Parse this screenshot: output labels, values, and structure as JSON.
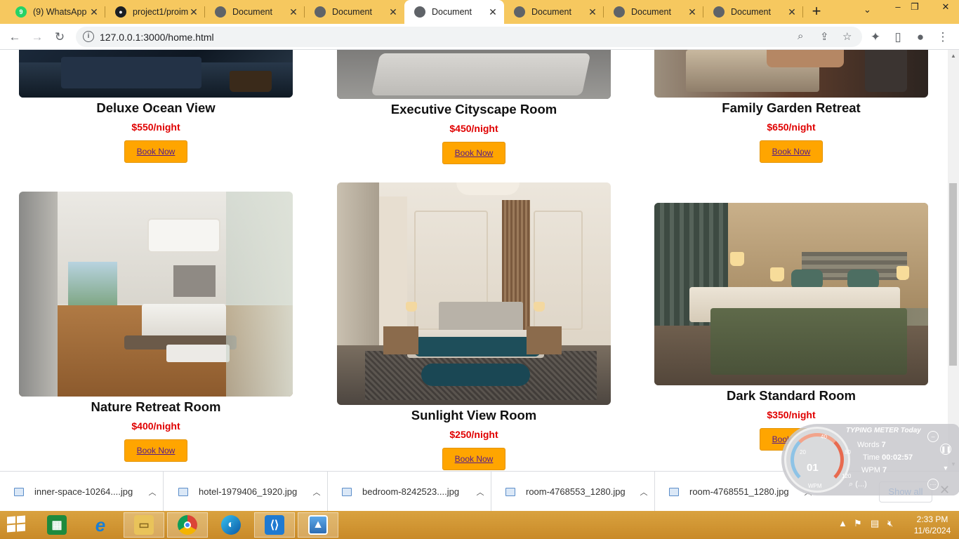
{
  "browser": {
    "tabs": [
      {
        "label": "(9) WhatsApp",
        "icon": "whatsapp-icon",
        "badge": "9",
        "active": false
      },
      {
        "label": "project1/proim",
        "icon": "github-icon",
        "active": false
      },
      {
        "label": "Document",
        "icon": "globe-icon",
        "active": false
      },
      {
        "label": "Document",
        "icon": "globe-icon",
        "active": false
      },
      {
        "label": "Document",
        "icon": "globe-icon",
        "active": true
      },
      {
        "label": "Document",
        "icon": "globe-icon",
        "active": false
      },
      {
        "label": "Document",
        "icon": "globe-icon",
        "active": false
      },
      {
        "label": "Document",
        "icon": "globe-icon",
        "active": false
      }
    ],
    "url": "127.0.0.1:3000/home.html"
  },
  "rooms": [
    {
      "name": "Deluxe Ocean View",
      "price": "$550/night",
      "button": "Book Now"
    },
    {
      "name": "Executive Cityscape Room",
      "price": "$450/night",
      "button": "Book Now"
    },
    {
      "name": "Family Garden Retreat",
      "price": "$650/night",
      "button": "Book Now"
    },
    {
      "name": "Nature Retreat Room",
      "price": "$400/night",
      "button": "Book Now"
    },
    {
      "name": "Sunlight View Room",
      "price": "$250/night",
      "button": "Book Now"
    },
    {
      "name": "Dark Standard Room",
      "price": "$350/night",
      "button": "Book Now"
    }
  ],
  "downloads": {
    "files": [
      "inner-space-10264....jpg",
      "hotel-1979406_1920.jpg",
      "bedroom-8242523....jpg",
      "room-4768553_1280.jpg",
      "room-4768551_1280.jpg"
    ],
    "show_all": "Show all"
  },
  "typing_meter": {
    "title": "TYPING METER Today",
    "words_label": "Words",
    "words": "7",
    "time_label": "Time",
    "time": "00:02:57",
    "wpm_label": "WPM",
    "wpm": "7",
    "dial_value": "01",
    "dial_label": "WPM",
    "ticks": [
      "20",
      "40",
      "80",
      "120"
    ],
    "search_hint": "(...)"
  },
  "taskbar": {
    "time": "2:33 PM",
    "date": "11/6/2024",
    "apps": [
      "excel-icon",
      "internet-explorer-icon",
      "file-explorer-icon",
      "chrome-icon",
      "edge-icon",
      "vscode-icon",
      "photos-icon"
    ]
  },
  "colors": {
    "tab_strip": "#f6c85f",
    "price": "#e00000",
    "button": "#ffa500",
    "taskbar": "#d9a23f"
  }
}
